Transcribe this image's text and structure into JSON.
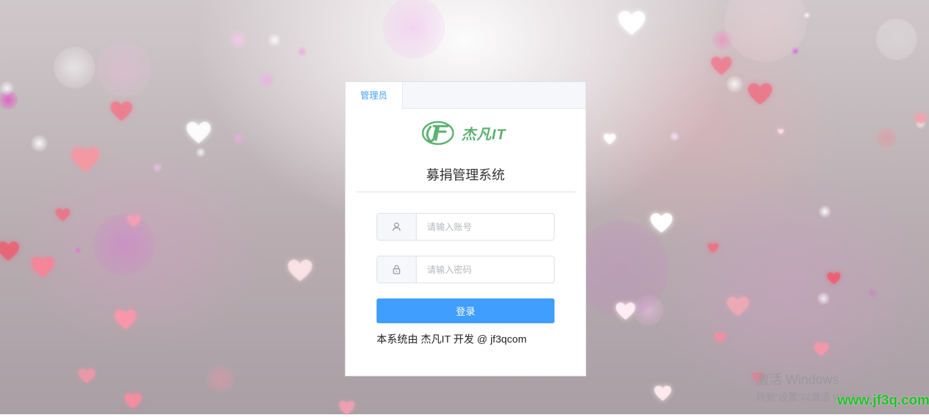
{
  "login": {
    "tab_label": "管理员",
    "brand_name": "杰凡IT",
    "system_title": "募捐管理系统",
    "username_placeholder": "请输入账号",
    "password_placeholder": "请输入密码",
    "username_value": "",
    "password_value": "",
    "login_button": "登录",
    "footer_text": "本系统由 杰凡IT 开发 @ jf3qcom"
  },
  "overlay": {
    "activate_title": "激活 Windows",
    "activate_sub": "转到“设置”以激活 Windows。",
    "watermark": "www.jf3q.com"
  },
  "colors": {
    "accent": "#409eff",
    "brand_green": "#5bb070",
    "watermark_green": "#22c02a"
  },
  "icons": [
    "user-icon",
    "lock-icon",
    "jf-logo-icon",
    "heart-icon"
  ]
}
